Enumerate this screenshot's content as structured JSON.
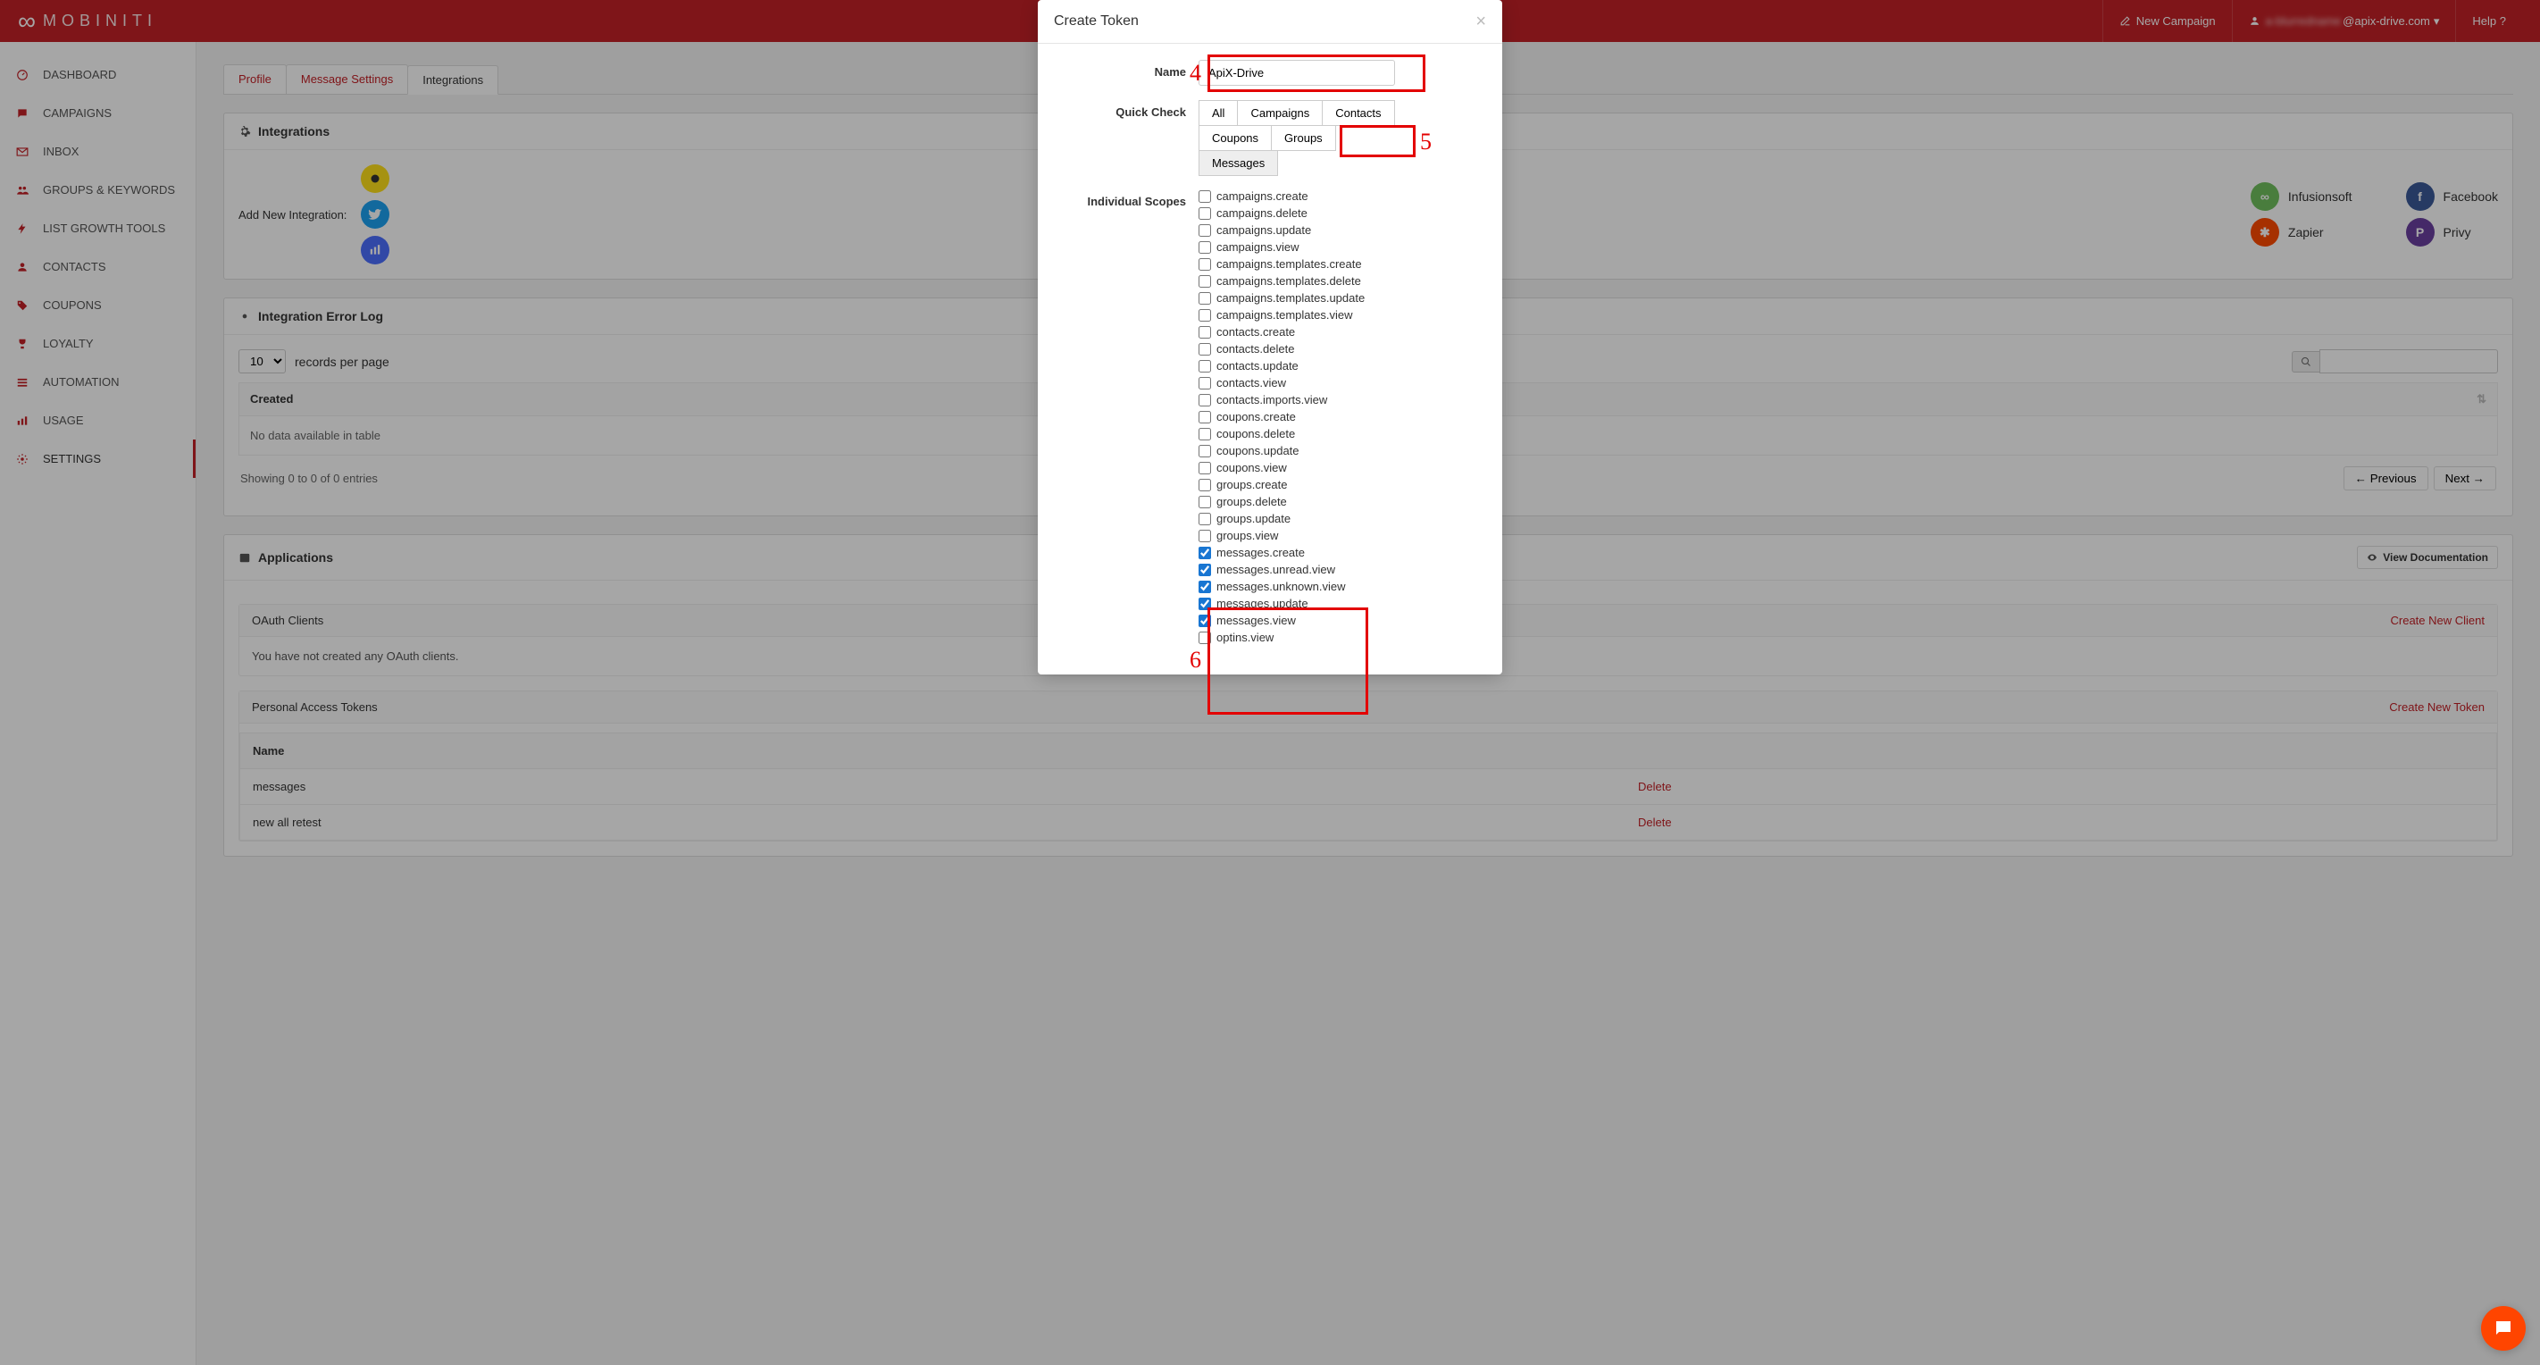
{
  "header": {
    "brand": "MOBINITI",
    "new_campaign": "New Campaign",
    "user_email": "@apix-drive.com",
    "help": "Help ?"
  },
  "sidebar": {
    "items": [
      {
        "label": "DASHBOARD",
        "icon": "dashboard-icon"
      },
      {
        "label": "CAMPAIGNS",
        "icon": "comment-icon"
      },
      {
        "label": "INBOX",
        "icon": "envelope-icon"
      },
      {
        "label": "GROUPS & KEYWORDS",
        "icon": "users-icon"
      },
      {
        "label": "LIST GROWTH TOOLS",
        "icon": "bolt-icon"
      },
      {
        "label": "CONTACTS",
        "icon": "user-icon"
      },
      {
        "label": "COUPONS",
        "icon": "tag-icon"
      },
      {
        "label": "LOYALTY",
        "icon": "trophy-icon"
      },
      {
        "label": "AUTOMATION",
        "icon": "sliders-icon"
      },
      {
        "label": "USAGE",
        "icon": "chart-icon"
      },
      {
        "label": "SETTINGS",
        "icon": "gear-icon"
      }
    ]
  },
  "tabs": {
    "profile": "Profile",
    "message_settings": "Message Settings",
    "integrations": "Integrations"
  },
  "integrations_panel": {
    "title": "Integrations",
    "add_new": "Add New Integration:",
    "names": {
      "infusionsoft": "Infusionsoft",
      "zapier": "Zapier",
      "facebook": "Facebook",
      "privy": "Privy"
    }
  },
  "error_log": {
    "title": "Integration Error Log",
    "records_per_page": "records per page",
    "select_value": "10",
    "created": "Created",
    "no_data": "No data available in table",
    "showing": "Showing 0 to 0 of 0 entries",
    "prev": "← Previous",
    "next": "Next →"
  },
  "applications": {
    "title": "Applications",
    "view_docs": "View Documentation",
    "oauth_header": "OAuth Clients",
    "create_client": "Create New Client",
    "oauth_empty": "You have not created any OAuth clients.",
    "tokens_header": "Personal Access Tokens",
    "create_token": "Create New Token",
    "th_name": "Name",
    "rows": [
      {
        "name": "messages",
        "action": "Delete"
      },
      {
        "name": "new all retest",
        "action": "Delete"
      }
    ]
  },
  "modal": {
    "title": "Create Token",
    "labels": {
      "name": "Name",
      "quick_check": "Quick Check",
      "individual_scopes": "Individual Scopes"
    },
    "name_value": "ApiX-Drive",
    "quick": {
      "all": "All",
      "campaigns": "Campaigns",
      "contacts": "Contacts",
      "coupons": "Coupons",
      "groups": "Groups",
      "messages": "Messages"
    },
    "scopes": [
      {
        "label": "campaigns.create",
        "checked": false
      },
      {
        "label": "campaigns.delete",
        "checked": false
      },
      {
        "label": "campaigns.update",
        "checked": false
      },
      {
        "label": "campaigns.view",
        "checked": false
      },
      {
        "label": "campaigns.templates.create",
        "checked": false
      },
      {
        "label": "campaigns.templates.delete",
        "checked": false
      },
      {
        "label": "campaigns.templates.update",
        "checked": false
      },
      {
        "label": "campaigns.templates.view",
        "checked": false
      },
      {
        "label": "contacts.create",
        "checked": false
      },
      {
        "label": "contacts.delete",
        "checked": false
      },
      {
        "label": "contacts.update",
        "checked": false
      },
      {
        "label": "contacts.view",
        "checked": false
      },
      {
        "label": "contacts.imports.view",
        "checked": false
      },
      {
        "label": "coupons.create",
        "checked": false
      },
      {
        "label": "coupons.delete",
        "checked": false
      },
      {
        "label": "coupons.update",
        "checked": false
      },
      {
        "label": "coupons.view",
        "checked": false
      },
      {
        "label": "groups.create",
        "checked": false
      },
      {
        "label": "groups.delete",
        "checked": false
      },
      {
        "label": "groups.update",
        "checked": false
      },
      {
        "label": "groups.view",
        "checked": false
      },
      {
        "label": "messages.create",
        "checked": true
      },
      {
        "label": "messages.unread.view",
        "checked": true
      },
      {
        "label": "messages.unknown.view",
        "checked": true
      },
      {
        "label": "messages.update",
        "checked": true
      },
      {
        "label": "messages.view",
        "checked": true
      },
      {
        "label": "optins.view",
        "checked": false
      }
    ]
  },
  "annotations": {
    "4": "4",
    "5": "5",
    "6": "6"
  }
}
